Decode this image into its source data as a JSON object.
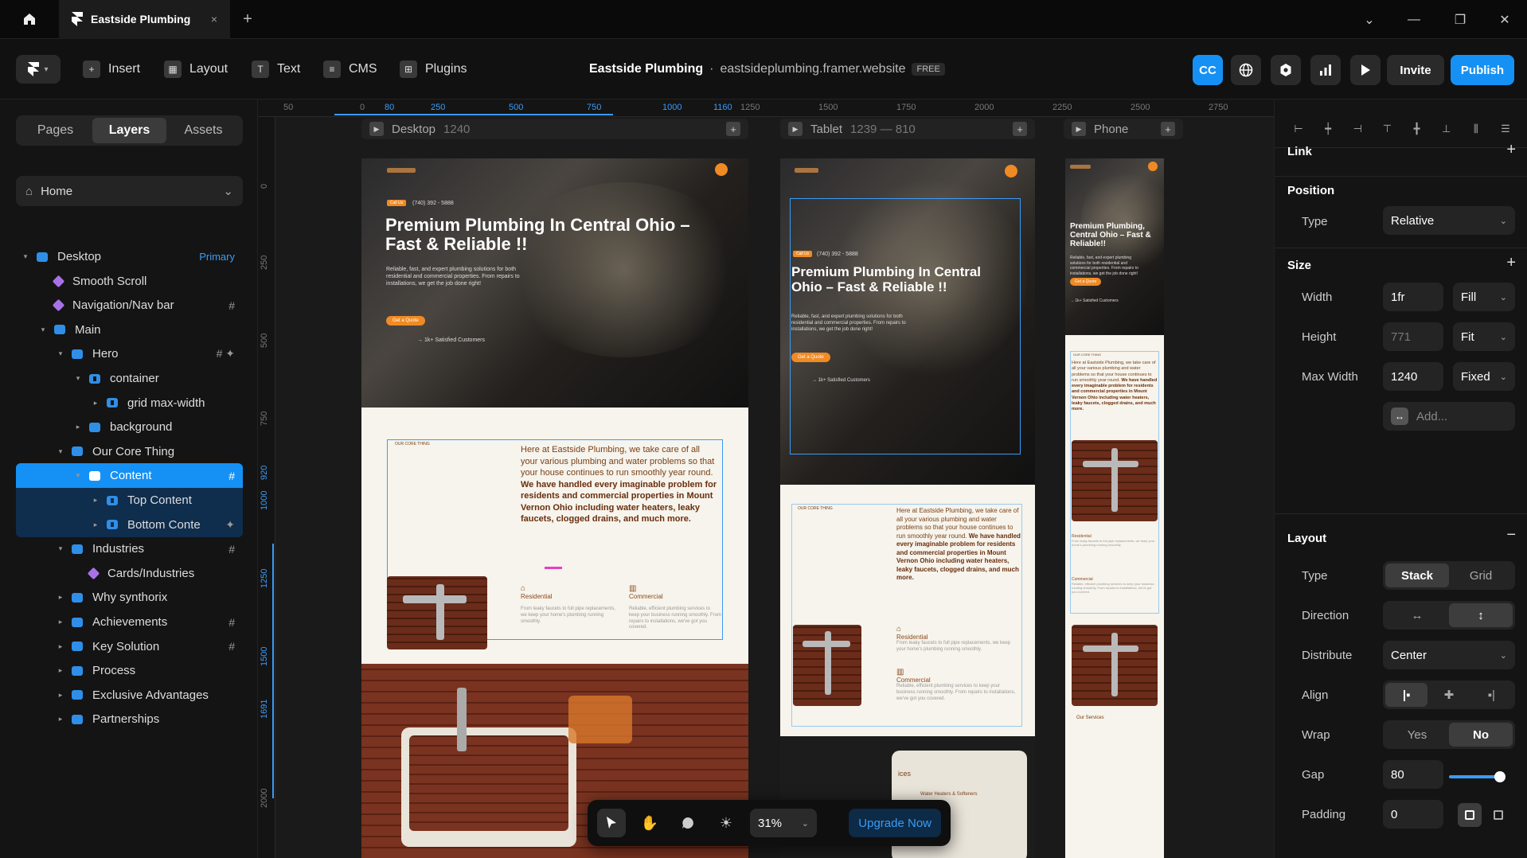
{
  "window": {
    "tab_title": "Eastside Plumbing",
    "tab_close": "×",
    "new_tab": "+",
    "controls": {
      "dropdown": "⌄",
      "minimize": "—",
      "maximize": "❐",
      "close": "✕"
    }
  },
  "toolbar": {
    "items": [
      {
        "label": "Insert",
        "icon": "plus-square-icon",
        "glyph": "+"
      },
      {
        "label": "Layout",
        "icon": "layout-icon",
        "glyph": "▦"
      },
      {
        "label": "Text",
        "icon": "text-icon",
        "glyph": "T"
      },
      {
        "label": "CMS",
        "icon": "database-icon",
        "glyph": "≡"
      },
      {
        "label": "Plugins",
        "icon": "plugins-icon",
        "glyph": "⊞"
      }
    ],
    "site_name": "Eastside Plumbing",
    "separator": "·",
    "site_url": "eastsideplumbing.framer.website",
    "plan": "FREE",
    "cc": "CC",
    "invite": "Invite",
    "publish": "Publish"
  },
  "left_panel": {
    "tabs": [
      "Pages",
      "Layers",
      "Assets"
    ],
    "active_tab": "Layers",
    "page": "Home",
    "layers": [
      {
        "label": "Desktop",
        "badge": "Primary",
        "indent": 0,
        "icon": "frame",
        "expand": "▾"
      },
      {
        "label": "Smooth Scroll",
        "indent": 1,
        "icon": "component"
      },
      {
        "label": "Navigation/Nav bar",
        "indent": 1,
        "icon": "component",
        "badge": "#"
      },
      {
        "label": "Main",
        "indent": 1,
        "icon": "frame",
        "expand": "▾"
      },
      {
        "label": "Hero",
        "indent": 2,
        "icon": "frame",
        "expand": "▾",
        "badge": "# ✦"
      },
      {
        "label": "container",
        "indent": 3,
        "icon": "stack",
        "expand": "▾"
      },
      {
        "label": "grid max-width",
        "indent": 4,
        "icon": "grid",
        "expand": "▸"
      },
      {
        "label": "background",
        "indent": 3,
        "icon": "frame",
        "expand": "▸"
      },
      {
        "label": "Our Core Thing",
        "indent": 2,
        "icon": "frame",
        "expand": "▾"
      },
      {
        "label": "Content",
        "indent": 3,
        "icon": "frame",
        "expand": "▾",
        "badge": "#",
        "state": "selected"
      },
      {
        "label": "Top Content",
        "indent": 4,
        "icon": "stack",
        "expand": "▸",
        "state": "child"
      },
      {
        "label": "Bottom Conte",
        "indent": 4,
        "icon": "stack",
        "expand": "▸",
        "badge": "✦",
        "state": "child-last"
      },
      {
        "label": "Industries",
        "indent": 2,
        "icon": "frame",
        "expand": "▾",
        "badge": "#"
      },
      {
        "label": "Cards/Industries",
        "indent": 3,
        "icon": "component"
      },
      {
        "label": "Why synthorix",
        "indent": 2,
        "icon": "frame",
        "expand": "▸"
      },
      {
        "label": "Achievements",
        "indent": 2,
        "icon": "frame",
        "expand": "▸",
        "badge": "#"
      },
      {
        "label": "Key Solution",
        "indent": 2,
        "icon": "frame",
        "expand": "▸",
        "badge": "#"
      },
      {
        "label": "Process",
        "indent": 2,
        "icon": "frame",
        "expand": "▸"
      },
      {
        "label": "Exclusive Advantages",
        "indent": 2,
        "icon": "frame",
        "expand": "▸"
      },
      {
        "label": "Partnerships",
        "indent": 2,
        "icon": "frame",
        "expand": "▸"
      }
    ]
  },
  "canvas": {
    "ruler_x": [
      "50",
      "0",
      "80",
      "250",
      "500",
      "750",
      "1000",
      "1160",
      "1250",
      "1500",
      "1750",
      "2000",
      "2250",
      "2500",
      "2750"
    ],
    "ruler_y": [
      "0",
      "250",
      "500",
      "750",
      "920",
      "1000",
      "1250",
      "1500",
      "1691",
      "2000"
    ],
    "frames": [
      {
        "name": "Desktop",
        "size": "1240"
      },
      {
        "name": "Tablet",
        "size": "1239 — 810"
      },
      {
        "name": "Phone",
        "size": ""
      }
    ],
    "hero_heading_desktop": "Premium Plumbing In Central Ohio – Fast & Reliable !!",
    "hero_heading_tablet": "Premium Plumbing In Central Ohio – Fast & Reliable !!",
    "hero_heading_phone": "Premium Plumbing, Central Ohio – Fast & Reliable!!",
    "hero_para": "Reliable, fast, and expert plumbing solutions for both residential and commercial properties. From repairs to installations, we get the job done right!",
    "hero_cta": "Get a Quote",
    "hero_customers": "→ 1k+ Satisfied Customers",
    "hero_chip": "Call Us",
    "hero_phone": "(740) 392 - 5888",
    "core_label": "OUR CORE THING",
    "core_text_normal": "Here at Eastside Plumbing, we take care of all your various plumbing and water problems so that your house continues to run smoothly year round.",
    "core_text_bold": "We have handled every imaginable problem for residents and commercial properties in Mount Vernon Ohio including water heaters, leaky faucets, clogged drains, and much more.",
    "residential_title": "Residential",
    "residential_text": "From leaky faucets to full pipe replacements, we keep your home's plumbing running smoothly.",
    "commercial_title": "Commercial",
    "commercial_text": "Reliable, efficient plumbing services to keep your business running smoothly. From repairs to installations, we've got you covered.",
    "our_services": "Our Services",
    "tablet_services": "ices",
    "tablet_services_item": "Water Heaters & Softeners"
  },
  "floatbar": {
    "zoom": "31%",
    "upgrade": "Upgrade Now"
  },
  "right_panel": {
    "link": "Link",
    "position": {
      "title": "Position",
      "type_label": "Type",
      "type_value": "Relative"
    },
    "size": {
      "title": "Size",
      "width_label": "Width",
      "width_value": "1fr",
      "width_mode": "Fill",
      "height_label": "Height",
      "height_value": "771",
      "height_mode": "Fit",
      "maxwidth_label": "Max Width",
      "maxwidth_value": "1240",
      "maxwidth_mode": "Fixed",
      "add_label": "Add..."
    },
    "layout": {
      "title": "Layout",
      "type_label": "Type",
      "type_options": [
        "Stack",
        "Grid"
      ],
      "type_active": "Stack",
      "direction_label": "Direction",
      "direction_options": [
        "↔",
        "↕"
      ],
      "direction_active": "↕",
      "distribute_label": "Distribute",
      "distribute_value": "Center",
      "align_label": "Align",
      "align_options": [
        "|▪",
        "✚",
        "▪|"
      ],
      "wrap_label": "Wrap",
      "wrap_options": [
        "Yes",
        "No"
      ],
      "wrap_active": "No",
      "gap_label": "Gap",
      "gap_value": "80",
      "gap_level": 0.8,
      "padding_label": "Padding",
      "padding_value": "0"
    }
  },
  "colors": {
    "accent": "#1591f5",
    "orange": "#f08a24",
    "brown_text": "#7a3f18",
    "cream": "#f6f4ec"
  }
}
